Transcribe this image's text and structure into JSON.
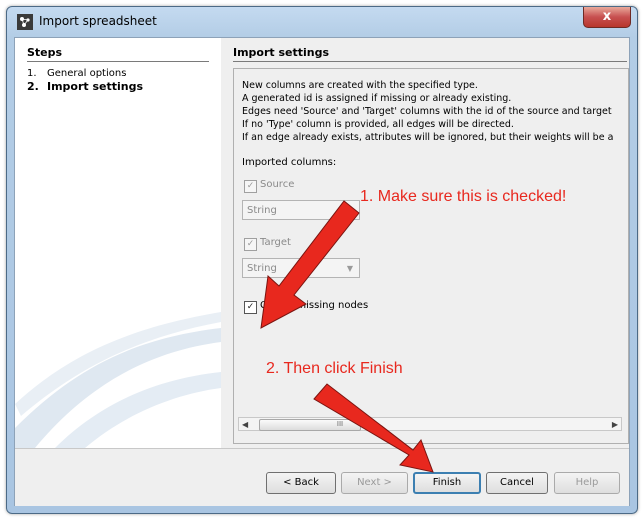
{
  "window": {
    "title": "Import spreadsheet",
    "close_glyph": "x",
    "app_icon": "gephi-icon"
  },
  "steps": {
    "heading": "Steps",
    "items": [
      {
        "num": "1.",
        "label": "General options",
        "bold": false
      },
      {
        "num": "2.",
        "label": "Import settings",
        "bold": true
      }
    ]
  },
  "settings": {
    "heading": "Import settings",
    "info_lines": [
      "New columns are created with the specified type.",
      "A generated id is assigned if missing or already existing.",
      "Edges need 'Source' and 'Target' columns with the id of the source and target",
      "If no 'Type' column is provided, all edges will be directed.",
      "If an edge already exists, attributes will be ignored, but their weights will be a"
    ],
    "imported_columns_label": "Imported columns:",
    "source": {
      "label": "Source",
      "checked": true,
      "type": "String"
    },
    "target": {
      "label": "Target",
      "checked": true,
      "type": "String"
    },
    "create_missing_nodes": {
      "label": "Create missing nodes",
      "checked": true
    },
    "scroll_thumb_mark": "III"
  },
  "buttons": {
    "back": "< Back",
    "next": "Next >",
    "finish": "Finish",
    "cancel": "Cancel",
    "help": "Help"
  },
  "annotations": {
    "step1": "1. Make sure this is checked!",
    "step2": "2. Then click Finish",
    "color": "#e8281e"
  }
}
